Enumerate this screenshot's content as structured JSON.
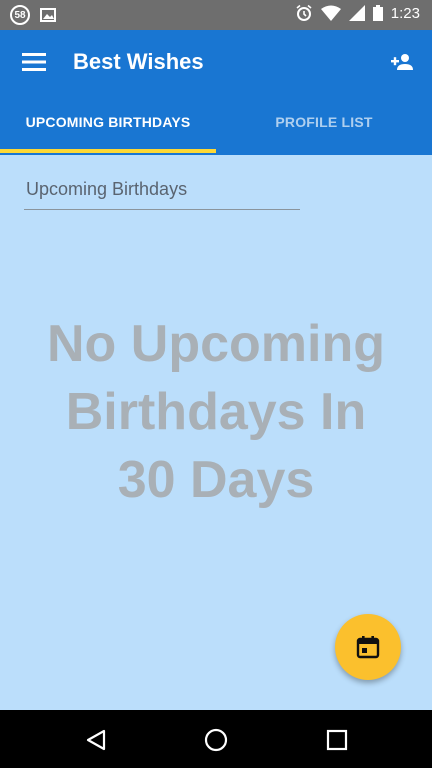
{
  "status_bar": {
    "notification_count": "58",
    "time": "1:23",
    "icons": [
      "badge-icon",
      "image-icon",
      "alarm-icon",
      "wifi-icon",
      "signal-icon",
      "battery-icon"
    ]
  },
  "app_bar": {
    "title": "Best Wishes",
    "menu_icon": "menu-icon",
    "action_icon": "add-person-icon",
    "color": "#1976d2"
  },
  "tabs": [
    {
      "label": "UPCOMING BIRTHDAYS",
      "selected": true
    },
    {
      "label": "PROFILE LIST",
      "selected": false
    }
  ],
  "indicator_color": "#fdd835",
  "search": {
    "placeholder": "Upcoming Birthdays"
  },
  "empty_state": {
    "line1": "No Upcoming",
    "line2": "Birthdays In",
    "line3": "30 Days"
  },
  "fab": {
    "icon": "calendar-icon",
    "color": "#fbc02d"
  },
  "nav_bar": {
    "buttons": [
      "back-icon",
      "home-icon",
      "recents-icon"
    ]
  }
}
